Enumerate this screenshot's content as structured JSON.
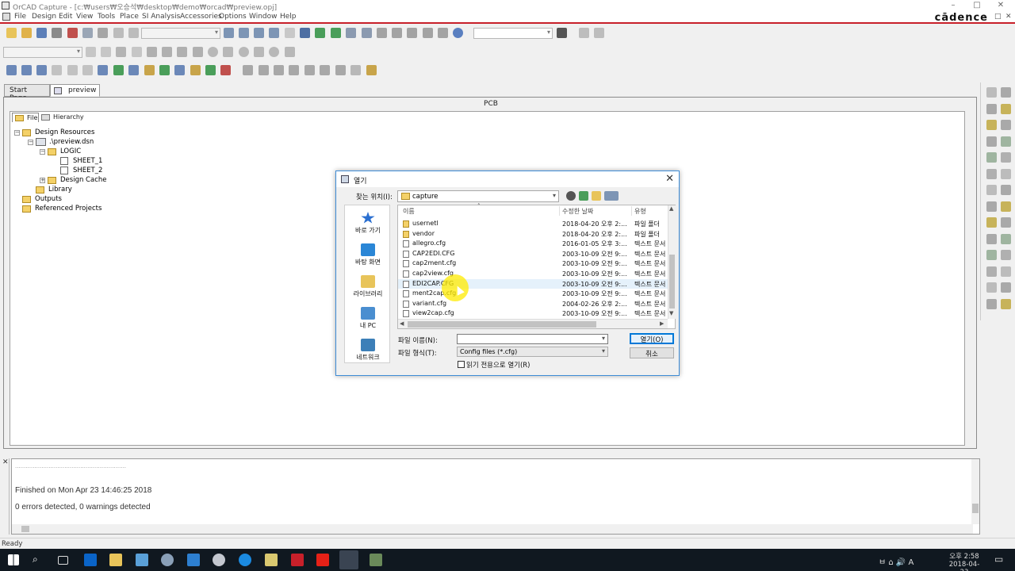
{
  "window": {
    "title": "OrCAD Capture - [c:₩users₩오승석₩desktop₩demo₩orcad₩preview.opj]",
    "controls": [
      "–",
      "□",
      "✕"
    ]
  },
  "menubar": {
    "items": [
      "File",
      "Design",
      "Edit",
      "View",
      "Tools",
      "Place",
      "SI Analysis",
      "Accessories",
      "Options",
      "Window",
      "Help"
    ],
    "brand": "cādence",
    "mdi_controls": [
      "–",
      "□",
      "✕"
    ]
  },
  "tabs": [
    {
      "label": "Start Page",
      "active": false
    },
    {
      "label": "preview",
      "active": true
    }
  ],
  "main": {
    "pane_title": "PCB",
    "tree_tabs": [
      "File",
      "Hierarchy"
    ],
    "tree": [
      {
        "label": "Design Resources",
        "type": "folder",
        "level": 0,
        "exp": "−"
      },
      {
        "label": ".\\preview.dsn",
        "type": "design",
        "level": 1,
        "exp": "−"
      },
      {
        "label": "LOGIC",
        "type": "folder",
        "level": 2,
        "exp": "−"
      },
      {
        "label": "SHEET_1",
        "type": "page",
        "level": 3,
        "exp": ""
      },
      {
        "label": "SHEET_2",
        "type": "page",
        "level": 3,
        "exp": ""
      },
      {
        "label": "Design Cache",
        "type": "folder",
        "level": 2,
        "exp": "+"
      },
      {
        "label": "Library",
        "type": "folder",
        "level": 1,
        "exp": ""
      },
      {
        "label": "Outputs",
        "type": "folder",
        "level": 0,
        "exp": ""
      },
      {
        "label": "Referenced Projects",
        "type": "folder",
        "level": 0,
        "exp": ""
      }
    ]
  },
  "session_log": {
    "separator": "...............................................................",
    "lines": [
      "Finished on Mon Apr 23 14:46:25 2018",
      "0 errors detected, 0 warnings detected"
    ]
  },
  "status": {
    "text": "Ready"
  },
  "taskbar": {
    "tray_text": "ㅂ  ⌂  🔊  A",
    "time": "오후 2:58",
    "date": "2018-04-23"
  },
  "dialog": {
    "title": "열기",
    "look_in_label": "찾는 위치(I):",
    "look_in_value": "capture",
    "places": [
      "바로 가기",
      "바탕 화면",
      "라이브러리",
      "내 PC",
      "네트워크"
    ],
    "columns": [
      "이름",
      "수정한 날짜",
      "유형"
    ],
    "files": [
      {
        "name": "usernetl",
        "date": "2018-04-20 오후 2:...",
        "type": "파일 폴더",
        "kind": "folder"
      },
      {
        "name": "vendor",
        "date": "2018-04-20 오후 2:...",
        "type": "파일 폴더",
        "kind": "folder"
      },
      {
        "name": "allegro.cfg",
        "date": "2016-01-05 오후 3:...",
        "type": "텍스트 문서",
        "kind": "cfg"
      },
      {
        "name": "CAP2EDI.CFG",
        "date": "2003-10-09 오전 9:...",
        "type": "텍스트 문서",
        "kind": "cfg"
      },
      {
        "name": "cap2ment.cfg",
        "date": "2003-10-09 오전 9:...",
        "type": "텍스트 문서",
        "kind": "cfg"
      },
      {
        "name": "cap2view.cfg",
        "date": "2003-10-09 오전 9:...",
        "type": "텍스트 문서",
        "kind": "cfg"
      },
      {
        "name": "EDI2CAP.CFG",
        "date": "2003-10-09 오전 9:...",
        "type": "텍스트 문서",
        "kind": "cfg",
        "hover": true
      },
      {
        "name": "ment2cap.cfg",
        "date": "2003-10-09 오전 9:...",
        "type": "텍스트 문서",
        "kind": "cfg"
      },
      {
        "name": "variant.cfg",
        "date": "2004-02-26 오후 2:...",
        "type": "텍스트 문서",
        "kind": "cfg"
      },
      {
        "name": "view2cap.cfg",
        "date": "2003-10-09 오전 9:...",
        "type": "텍스트 문서",
        "kind": "cfg"
      }
    ],
    "filename_label": "파일 이름(N):",
    "filename_value": "",
    "filetype_label": "파일 형식(T):",
    "filetype_value": "Config files (*.cfg)",
    "readonly_label": "읽기 전용으로 열기(R)",
    "readonly_checked": false,
    "open_button": "열기(O)",
    "cancel_button": "취소"
  },
  "colors": {
    "accent_red": "#c8202a",
    "dialog_border": "#3e8cd6",
    "default_button": "#0078d7",
    "taskbar": "#101820",
    "highlight": "#ffeb00"
  }
}
